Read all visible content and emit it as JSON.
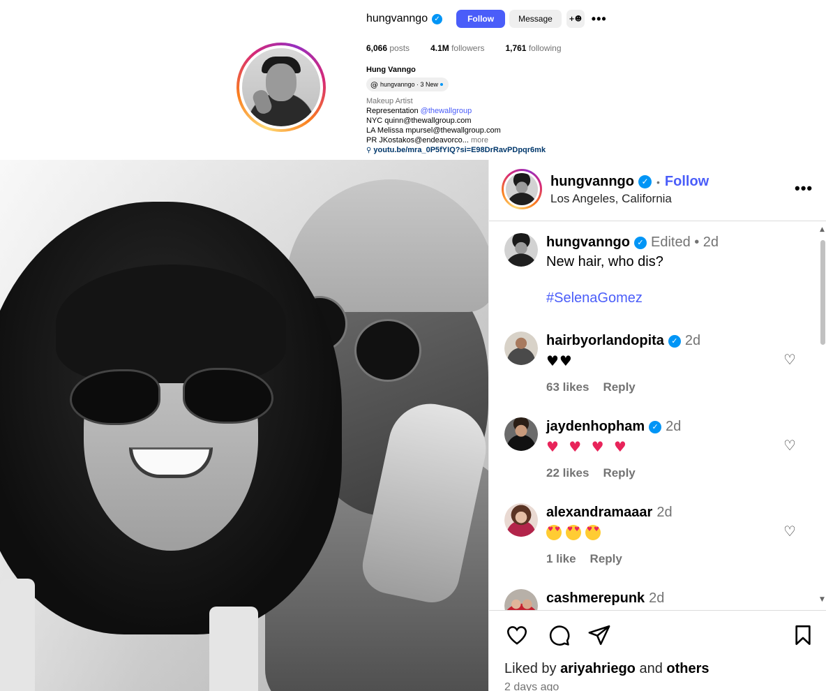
{
  "profile": {
    "username": "hungvanngo",
    "follow_label": "Follow",
    "message_label": "Message",
    "add_user_label": "+☻",
    "more_label": "•••",
    "stats": {
      "posts_value": "6,066",
      "posts_label": "posts",
      "followers_value": "4.1M",
      "followers_label": "followers",
      "following_value": "1,761",
      "following_label": "following"
    },
    "full_name": "Hung Vanngo",
    "threads_badge": "hungvanngo · 3 New",
    "bio": {
      "category": "Makeup Artist",
      "rep_prefix": "Representation",
      "rep_mention": "@thewallgroup",
      "line_nyc": "NYC quinn@thewallgroup.com",
      "line_la": "LA Melissa mpursel@thewallgroup.com",
      "line_pr": "PR JKostakos@endeavorco...",
      "more": "more",
      "link": "youtu.be/mra_0P5fYIQ?si=E98DrRavPDpqr6mk"
    }
  },
  "post": {
    "header": {
      "username": "hungvanngo",
      "separator": "•",
      "follow_label": "Follow",
      "location": "Los Angeles, California",
      "more_label": "•••"
    },
    "caption": {
      "username": "hungvanngo",
      "meta": "Edited •  2d",
      "text": "New hair, who dis?",
      "hashtag": "#SelenaGomez"
    },
    "comments": [
      {
        "username": "hairbyorlandopita",
        "time": "2d",
        "text": "♥♥",
        "likes": "63 likes",
        "reply": "Reply"
      },
      {
        "username": "jaydenhopham",
        "time": "2d",
        "text": "♥ ♥ ♥ ♥",
        "likes": "22 likes",
        "reply": "Reply"
      },
      {
        "username": "alexandramaaar",
        "time": "2d",
        "likes": "1 like",
        "reply": "Reply"
      },
      {
        "username": "cashmerepunk",
        "time": "2d"
      }
    ],
    "liked_by": {
      "prefix": "Liked by",
      "user": "ariyahriego",
      "middle": "and",
      "others": "others"
    },
    "time_ago": "2 days ago"
  },
  "colors": {
    "accent": "#4a5df9",
    "verified": "#0095f6",
    "muted_text": "#737373",
    "heart_red": "#e8245a"
  },
  "icons": [
    "verified-icon",
    "threads-icon",
    "heart-icon",
    "comment-icon",
    "share-icon",
    "bookmark-icon",
    "more-icon",
    "link-icon",
    "add-user-icon"
  ]
}
